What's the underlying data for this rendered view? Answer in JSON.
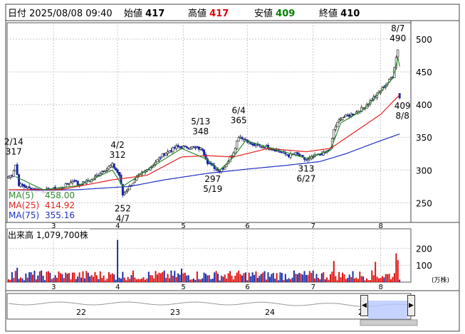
{
  "header": {
    "date_label": "日付",
    "datetime": "2025/08/08 09:40",
    "open_label": "始値",
    "open": "417",
    "high_label": "高値",
    "high": "417",
    "low_label": "安値",
    "low": "409",
    "close_label": "終値",
    "close": "410"
  },
  "colors": {
    "up_candle": "#ffffff",
    "down_candle": "#1428a0",
    "ma5": "#2f8a2f",
    "ma25": "#e02020",
    "ma75": "#2030c0",
    "vol_up": "#e01414",
    "vol_down": "#1c2fa8",
    "grid": "#c8c8c8"
  },
  "ma_legend": [
    {
      "label": "MA(5)",
      "value": "458.00",
      "color": "#2f8a2f"
    },
    {
      "label": "MA(25)",
      "value": "414.92",
      "color": "#e02020"
    },
    {
      "label": "MA(75)",
      "value": "355.16",
      "color": "#2030c0"
    }
  ],
  "volume_label": "出来高 1,079,700株",
  "volume_unit": "(万株)",
  "chart_data": [
    {
      "type": "candlestick",
      "title": "",
      "x_tick_labels": [
        "3",
        "4",
        "5",
        "6",
        "7",
        "8"
      ],
      "y_ticks": [
        250,
        300,
        350,
        400,
        450,
        500
      ],
      "ylim": [
        220,
        525
      ],
      "grid": true,
      "annotations": [
        {
          "text": [
            "2/14",
            "317"
          ],
          "date": "2/14",
          "value": 317,
          "kind": "high"
        },
        {
          "text": [
            "4/2",
            "312"
          ],
          "date": "4/2",
          "value": 312,
          "kind": "high"
        },
        {
          "text": [
            "252",
            "4/7"
          ],
          "date": "4/7",
          "value": 252,
          "kind": "low"
        },
        {
          "text": [
            "5/13",
            "348"
          ],
          "date": "5/13",
          "value": 348,
          "kind": "high"
        },
        {
          "text": [
            "297",
            "5/19"
          ],
          "date": "5/19",
          "value": 297,
          "kind": "low"
        },
        {
          "text": [
            "6/4",
            "365"
          ],
          "date": "6/4",
          "value": 365,
          "kind": "high"
        },
        {
          "text": [
            "313",
            "6/27"
          ],
          "date": "6/27",
          "value": 313,
          "kind": "low"
        },
        {
          "text": [
            "8/7",
            "490"
          ],
          "date": "8/7",
          "value": 490,
          "kind": "high"
        },
        {
          "text": [
            "409",
            "8/8"
          ],
          "date": "8/8",
          "value": 409,
          "kind": "low"
        }
      ],
      "close_anchors": [
        [
          0,
          290
        ],
        [
          2,
          293
        ],
        [
          4,
          308
        ],
        [
          6,
          278
        ],
        [
          12,
          272
        ],
        [
          20,
          268
        ],
        [
          30,
          272
        ],
        [
          38,
          285
        ],
        [
          40,
          278
        ],
        [
          48,
          285
        ],
        [
          55,
          300
        ],
        [
          60,
          308
        ],
        [
          64,
          292
        ],
        [
          66,
          262
        ],
        [
          70,
          275
        ],
        [
          75,
          290
        ],
        [
          82,
          305
        ],
        [
          90,
          325
        ],
        [
          97,
          335
        ],
        [
          105,
          335
        ],
        [
          112,
          332
        ],
        [
          115,
          312
        ],
        [
          118,
          305
        ],
        [
          122,
          300
        ],
        [
          125,
          305
        ],
        [
          130,
          328
        ],
        [
          133,
          352
        ],
        [
          137,
          347
        ],
        [
          141,
          338
        ],
        [
          150,
          335
        ],
        [
          158,
          327
        ],
        [
          162,
          322
        ],
        [
          166,
          325
        ],
        [
          172,
          315
        ],
        [
          178,
          322
        ],
        [
          183,
          327
        ],
        [
          186,
          332
        ],
        [
          188,
          362
        ],
        [
          192,
          380
        ],
        [
          198,
          384
        ],
        [
          205,
          395
        ],
        [
          212,
          413
        ],
        [
          218,
          430
        ],
        [
          222,
          444
        ],
        [
          224,
          472
        ],
        [
          225,
          485
        ],
        [
          226,
          413
        ]
      ],
      "ma5_anchors": [
        [
          4,
          290
        ],
        [
          20,
          270
        ],
        [
          40,
          276
        ],
        [
          60,
          300
        ],
        [
          66,
          275
        ],
        [
          80,
          300
        ],
        [
          100,
          333
        ],
        [
          115,
          316
        ],
        [
          122,
          300
        ],
        [
          130,
          320
        ],
        [
          137,
          345
        ],
        [
          150,
          335
        ],
        [
          172,
          318
        ],
        [
          186,
          330
        ],
        [
          192,
          372
        ],
        [
          205,
          392
        ],
        [
          218,
          428
        ],
        [
          222,
          440
        ],
        [
          224,
          460
        ],
        [
          225,
          472
        ],
        [
          226,
          458
        ]
      ],
      "ma25_anchors": [
        [
          0,
          270
        ],
        [
          30,
          270
        ],
        [
          60,
          285
        ],
        [
          80,
          292
        ],
        [
          100,
          320
        ],
        [
          115,
          322
        ],
        [
          130,
          320
        ],
        [
          150,
          333
        ],
        [
          172,
          328
        ],
        [
          186,
          333
        ],
        [
          200,
          358
        ],
        [
          215,
          385
        ],
        [
          226,
          414.92
        ]
      ],
      "ma75_anchors": [
        [
          0,
          268
        ],
        [
          40,
          270
        ],
        [
          70,
          275
        ],
        [
          90,
          285
        ],
        [
          115,
          295
        ],
        [
          140,
          302
        ],
        [
          160,
          307
        ],
        [
          180,
          313
        ],
        [
          195,
          325
        ],
        [
          210,
          340
        ],
        [
          226,
          355.16
        ]
      ],
      "volume_scale": {
        "ticks": [
          100,
          200
        ],
        "unit": "万株",
        "ylim": [
          0,
          290
        ]
      },
      "last_volume": 1079700
    }
  ]
}
